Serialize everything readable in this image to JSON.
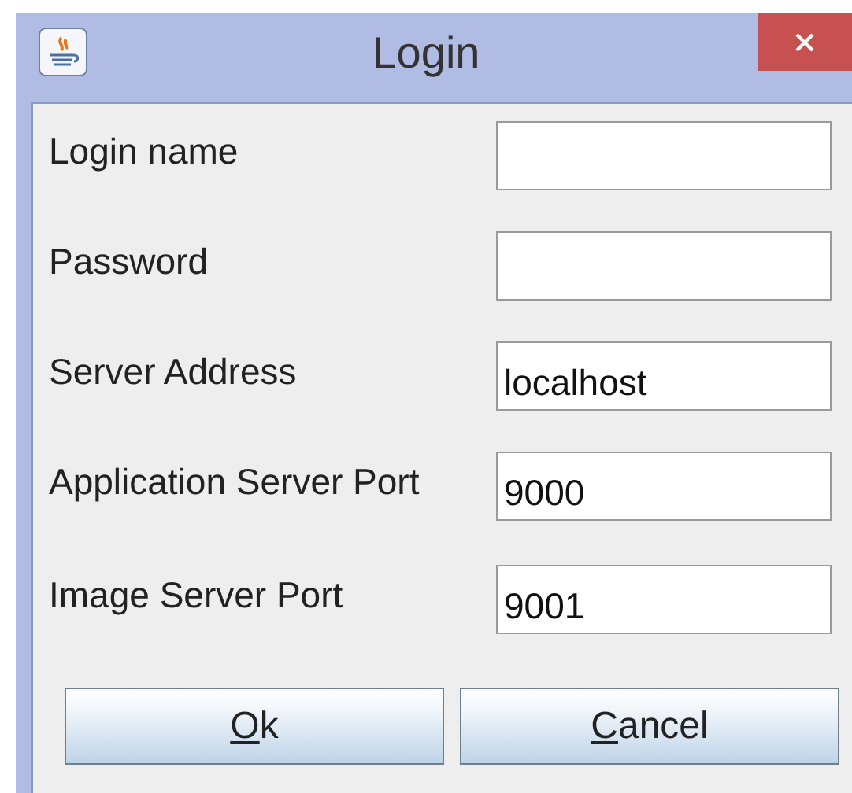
{
  "window": {
    "title": "Login"
  },
  "fields": [
    {
      "label": "Login name"
    },
    {
      "label": "Password"
    },
    {
      "label": "Server Address",
      "value": "localhost"
    },
    {
      "label": "Application Server Port",
      "value": "9000"
    },
    {
      "label": "Image Server Port",
      "value": "9001"
    }
  ],
  "buttons": [
    {
      "mnemonic": "O",
      "rest": "k"
    },
    {
      "mnemonic": "C",
      "rest": "ancel"
    }
  ]
}
